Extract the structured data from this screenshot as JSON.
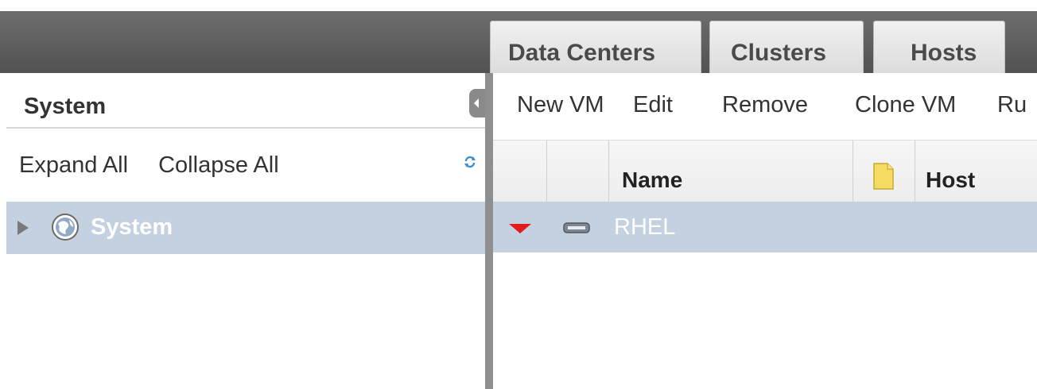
{
  "tabs": [
    {
      "label": "Data Centers"
    },
    {
      "label": "Clusters"
    },
    {
      "label": "Hosts"
    }
  ],
  "tree": {
    "title": "System",
    "expand_all": "Expand All",
    "collapse_all": "Collapse All",
    "refresh_icon": "refresh-icon",
    "nodes": [
      {
        "label": "System",
        "icon": "globe-icon",
        "expanded": false,
        "selected": true
      }
    ]
  },
  "toolbar": {
    "buttons": [
      {
        "label": "New VM"
      },
      {
        "label": "Edit"
      },
      {
        "label": "Remove"
      },
      {
        "label": "Clone VM"
      },
      {
        "label": "Ru"
      }
    ]
  },
  "grid": {
    "columns": [
      {
        "label": "Name"
      },
      {
        "label": "",
        "icon": "note-icon"
      },
      {
        "label": "Host"
      }
    ],
    "rows": [
      {
        "status": "down",
        "status_icon": "arrow-down-icon",
        "type_icon": "vm-icon",
        "name": "RHEL",
        "host": "",
        "selected": true
      }
    ]
  },
  "colors": {
    "selection": "#c4d1e1",
    "header_bar": "#585858",
    "status_down": "#e41b1b",
    "note_icon": "#f4dc62"
  }
}
